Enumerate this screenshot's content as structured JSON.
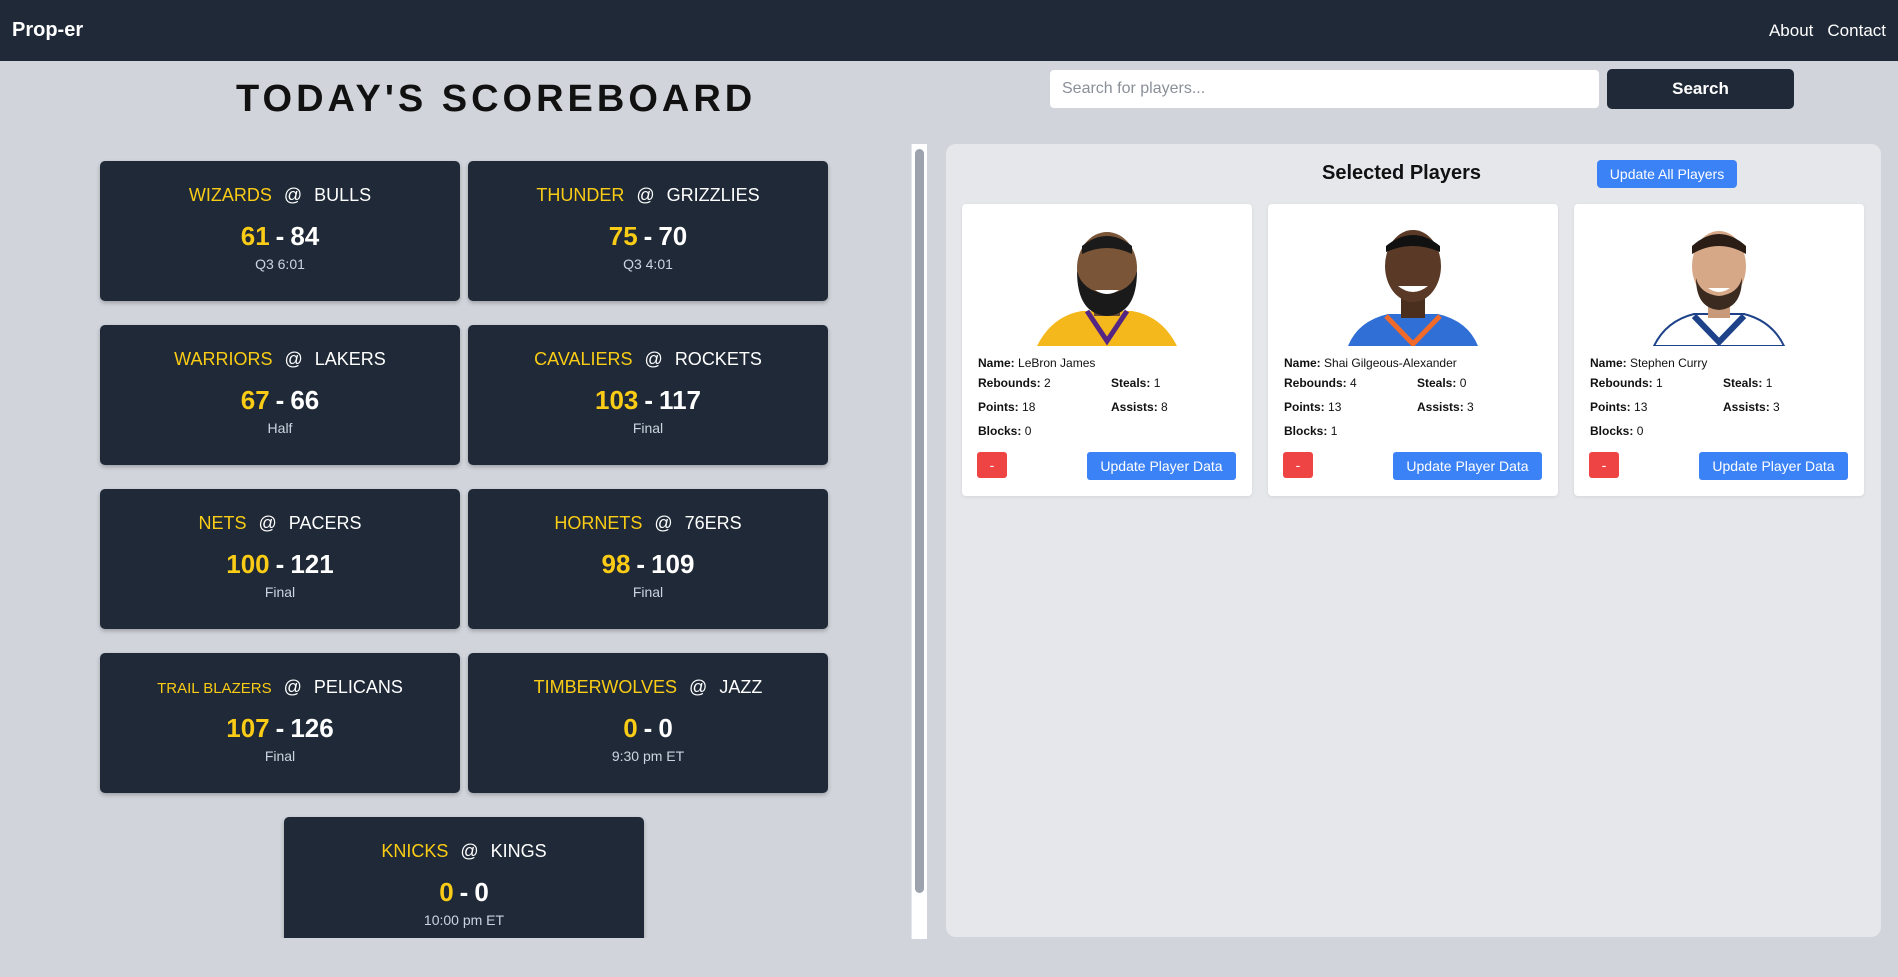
{
  "nav": {
    "brand": "Prop-er",
    "about": "About",
    "contact": "Contact"
  },
  "scoreboard": {
    "title": "Today's Scoreboard"
  },
  "search": {
    "placeholder": "Search for players...",
    "button": "Search"
  },
  "games": [
    {
      "away": "WIZARDS",
      "home": "BULLS",
      "away_score": "61",
      "home_score": "84",
      "status": "Q3 6:01"
    },
    {
      "away": "THUNDER",
      "home": "GRIZZLIES",
      "away_score": "75",
      "home_score": "70",
      "status": "Q3 4:01"
    },
    {
      "away": "WARRIORS",
      "home": "LAKERS",
      "away_score": "67",
      "home_score": "66",
      "status": "Half"
    },
    {
      "away": "CAVALIERS",
      "home": "ROCKETS",
      "away_score": "103",
      "home_score": "117",
      "status": "Final"
    },
    {
      "away": "NETS",
      "home": "PACERS",
      "away_score": "100",
      "home_score": "121",
      "status": "Final"
    },
    {
      "away": "HORNETS",
      "home": "76ERS",
      "away_score": "98",
      "home_score": "109",
      "status": "Final"
    },
    {
      "away": "TRAIL BLAZERS",
      "home": "PELICANS",
      "away_score": "107",
      "home_score": "126",
      "status": "Final"
    },
    {
      "away": "TIMBERWOLVES",
      "home": "JAZZ",
      "away_score": "0",
      "home_score": "0",
      "status": "9:30 pm ET"
    },
    {
      "away": "KNICKS",
      "home": "KINGS",
      "away_score": "0",
      "home_score": "0",
      "status": "10:00 pm ET"
    }
  ],
  "at_symbol": "@",
  "dash": "-",
  "selected": {
    "title": "Selected Players",
    "update_all": "Update All Players",
    "labels": {
      "name": "Name:",
      "rebounds": "Rebounds:",
      "steals": "Steals:",
      "points": "Points:",
      "assists": "Assists:",
      "blocks": "Blocks:"
    },
    "remove_label": "-",
    "update_label": "Update Player Data",
    "players": [
      {
        "name": "LeBron James",
        "rebounds": "2",
        "steals": "1",
        "points": "18",
        "assists": "8",
        "blocks": "0",
        "jersey_color": "#f5b81c",
        "jersey_trim": "#552583"
      },
      {
        "name": "Shai Gilgeous-Alexander",
        "rebounds": "4",
        "steals": "0",
        "points": "13",
        "assists": "3",
        "blocks": "1",
        "jersey_color": "#2f6fd6",
        "jersey_trim": "#f06a2b"
      },
      {
        "name": "Stephen Curry",
        "rebounds": "1",
        "steals": "1",
        "points": "13",
        "assists": "3",
        "blocks": "0",
        "jersey_color": "#ffffff",
        "jersey_trim": "#1d428a"
      }
    ]
  }
}
